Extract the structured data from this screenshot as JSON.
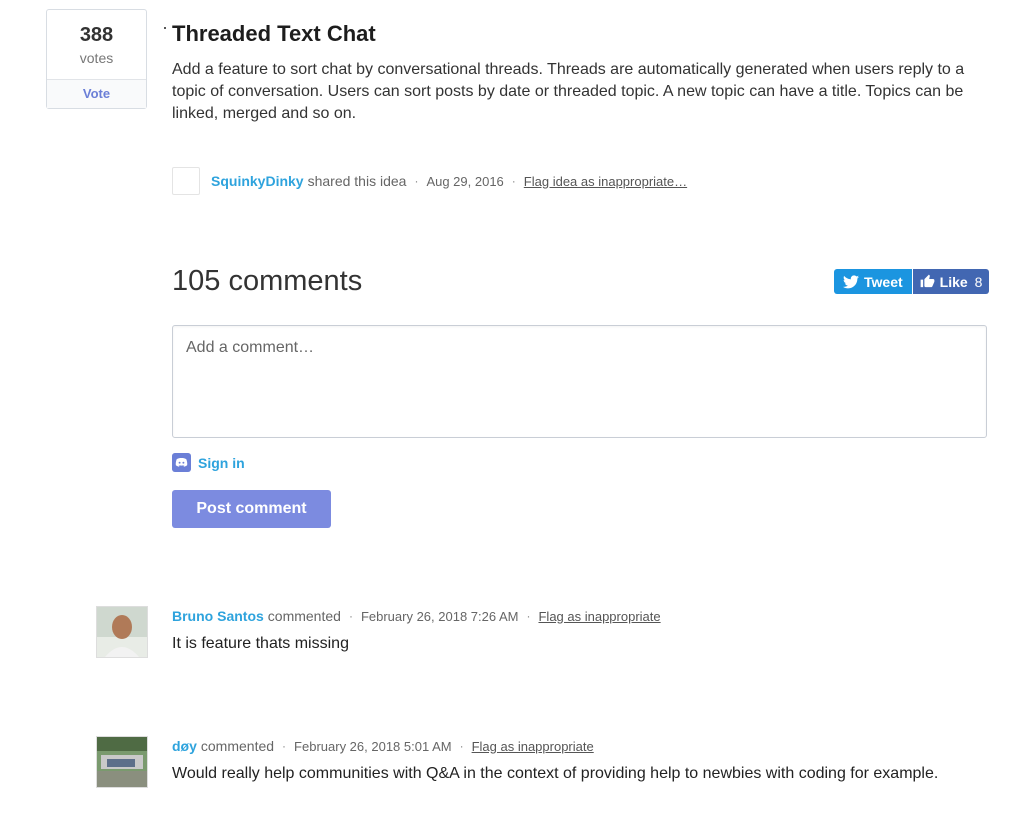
{
  "idea": {
    "votes": "388",
    "votes_label": "votes",
    "vote_button": "Vote",
    "title": "Threaded Text Chat",
    "body": "Add a feature to sort chat by conversational threads. Threads are automatically generated when users reply to a topic of conversation. Users can sort posts by date or threaded topic. A new topic can have a title. Topics can be linked, merged and so on.",
    "author": "SquinkyDinky",
    "shared_text": "shared this idea",
    "separator": "·",
    "date": "Aug 29, 2016",
    "flag_text": "Flag idea as inappropriate…"
  },
  "comments_section": {
    "heading": "105 comments",
    "tweet_label": "Tweet",
    "like_label": "Like",
    "like_count": "8",
    "placeholder": "Add a comment…",
    "sign_in_label": "Sign in",
    "post_button": "Post comment"
  },
  "comments": [
    {
      "author": "Bruno Santos",
      "action": "commented",
      "date": "February 26, 2018 7:26 AM",
      "flag_text": "Flag as inappropriate",
      "text": "It is feature thats missing"
    },
    {
      "author": "døy",
      "action": "commented",
      "date": "February 26, 2018 5:01 AM",
      "flag_text": "Flag as inappropriate",
      "text": "Would really help communities with Q&A in the context of providing help to newbies with coding for example."
    }
  ],
  "colors": {
    "link": "#2ea3dd",
    "vote_accent": "#6b7fd7",
    "post_button": "#7c8be0",
    "tweet": "#1b95e0",
    "facebook_like": "#4267b2"
  },
  "icons": [
    "twitter-bird-icon",
    "thumbs-up-icon",
    "discord-icon"
  ]
}
